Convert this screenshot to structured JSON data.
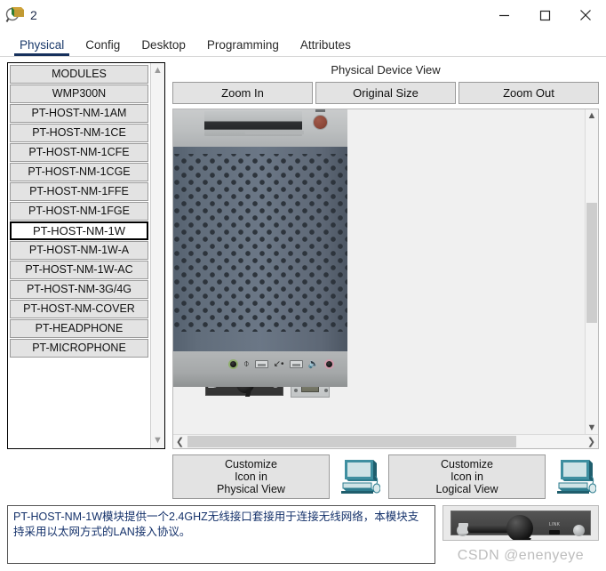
{
  "window": {
    "title": "2",
    "app_icon": "packet-tracer-magnifier-icon",
    "controls": {
      "minimize": "minimize-icon",
      "maximize": "maximize-icon",
      "close": "close-icon"
    }
  },
  "tabs": [
    {
      "label": "Physical",
      "active": true
    },
    {
      "label": "Config",
      "active": false
    },
    {
      "label": "Desktop",
      "active": false
    },
    {
      "label": "Programming",
      "active": false
    },
    {
      "label": "Attributes",
      "active": false
    }
  ],
  "modules": {
    "header": "MODULES",
    "items": [
      {
        "label": "WMP300N",
        "selected": false
      },
      {
        "label": "PT-HOST-NM-1AM",
        "selected": false
      },
      {
        "label": "PT-HOST-NM-1CE",
        "selected": false
      },
      {
        "label": "PT-HOST-NM-1CFE",
        "selected": false
      },
      {
        "label": "PT-HOST-NM-1CGE",
        "selected": false
      },
      {
        "label": "PT-HOST-NM-1FFE",
        "selected": false
      },
      {
        "label": "PT-HOST-NM-1FGE",
        "selected": false
      },
      {
        "label": "PT-HOST-NM-1W",
        "selected": true
      },
      {
        "label": "PT-HOST-NM-1W-A",
        "selected": false
      },
      {
        "label": "PT-HOST-NM-1W-AC",
        "selected": false
      },
      {
        "label": "PT-HOST-NM-3G/4G",
        "selected": false
      },
      {
        "label": "PT-HOST-NM-COVER",
        "selected": false
      },
      {
        "label": "PT-HEADPHONE",
        "selected": false
      },
      {
        "label": "PT-MICROPHONE",
        "selected": false
      }
    ],
    "scroll_up_icon": "chevron-up-icon",
    "scroll_down_icon": "chevron-down-icon"
  },
  "device_view": {
    "title": "Physical Device View",
    "zoom_in": "Zoom In",
    "original_size": "Original Size",
    "zoom_out": "Zoom Out",
    "scroll_up_icon": "chevron-up-icon",
    "scroll_down_icon": "chevron-down-icon",
    "scroll_left_icon": "chevron-left-icon",
    "scroll_right_icon": "chevron-right-icon"
  },
  "customize": {
    "physical_view_label": "Customize\nIcon in\nPhysical View",
    "physical_view_line1": "Customize",
    "physical_view_line2": "Icon in",
    "physical_view_line3": "Physical View",
    "logical_view_line1": "Customize",
    "logical_view_line2": "Icon in",
    "logical_view_line3": "Logical View",
    "physical_icon": "pc-computer-icon",
    "logical_icon": "pc-computer-icon"
  },
  "description": "PT-HOST-NM-1W模块提供一个2.4GHZ无线接口套接用于连接无线网络，本模块支持采用以太网方式的LAN接入协议。",
  "preview": {
    "module_name": "PT-HOST-NM-1W",
    "led_label": "LINK"
  },
  "watermark": "CSDN @enenyeye",
  "colors": {
    "tab_active": "#16305c",
    "description_text": "#15326b",
    "button_face": "#e3e3e3",
    "selected_item_bg": "#ffffff",
    "watermark": "#bdbdbd"
  }
}
